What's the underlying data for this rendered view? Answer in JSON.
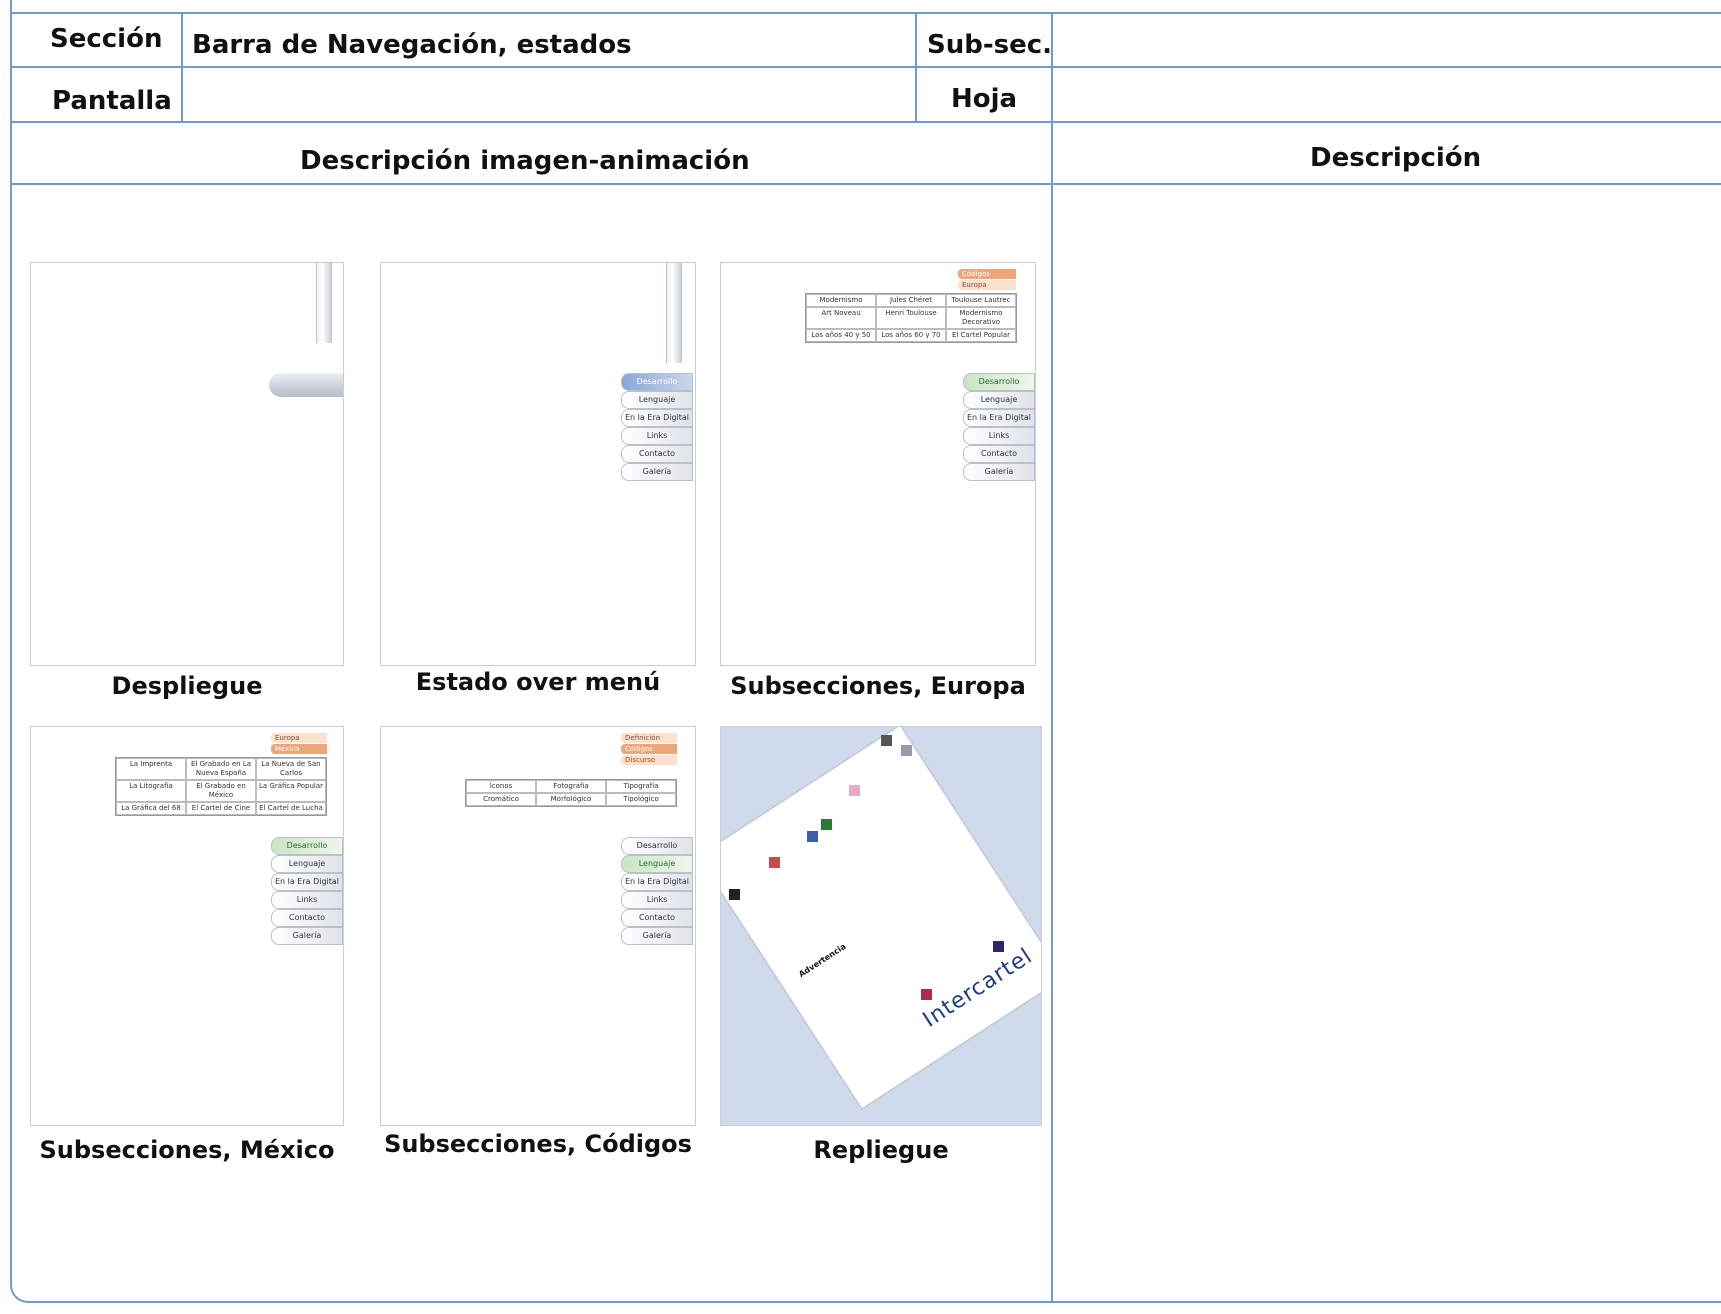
{
  "header": {
    "seccion_label": "Sección",
    "seccion_value": "Barra de Navegación, estados",
    "subsec_label": "Sub-sec.",
    "pantalla_label": "Pantalla",
    "hoja_label": "Hoja"
  },
  "columns": {
    "left": "Descripción imagen-animación",
    "right": "Descripción"
  },
  "captions": [
    "Despliegue",
    "Estado over menú",
    "Subsecciones, Europa",
    "Subsecciones, México",
    "Subsecciones, Códigos",
    "Repliegue"
  ],
  "menu": [
    "Desarrollo",
    "Lenguaje",
    "En la Era Digital",
    "Links",
    "Contacto",
    "Galería"
  ],
  "europa_tags": [
    "Códigos",
    "Europa"
  ],
  "europa_grid": [
    "Modernismo",
    "Jules Chéret",
    "Toulouse Lautrec",
    "Art Noveau",
    "Henri Toulouse",
    "Modernismo Decorativo",
    "Los años 40 y 50",
    "Los años 60 y 70",
    "El Cartel Popular"
  ],
  "mexico_tags": [
    "Europa",
    "México"
  ],
  "mexico_grid": [
    "La Imprenta",
    "El Grabado en La Nueva España",
    "La Nueva de San Carlos",
    "La Litografía",
    "El Grabado en México",
    "La Gráfica Popular",
    "La Gráfica del 68",
    "El Cartel de Cine",
    "El Cartel de Lucha"
  ],
  "codigos_tags": [
    "Definición",
    "Códigos",
    "Discurso"
  ],
  "codigos_grid": [
    "Íconos",
    "Fotografía",
    "Tipografía",
    "Cromático",
    "Morfológico",
    "Tipológico"
  ],
  "repliegue": {
    "brand": "Intercartel",
    "heading": "Advertencia"
  }
}
